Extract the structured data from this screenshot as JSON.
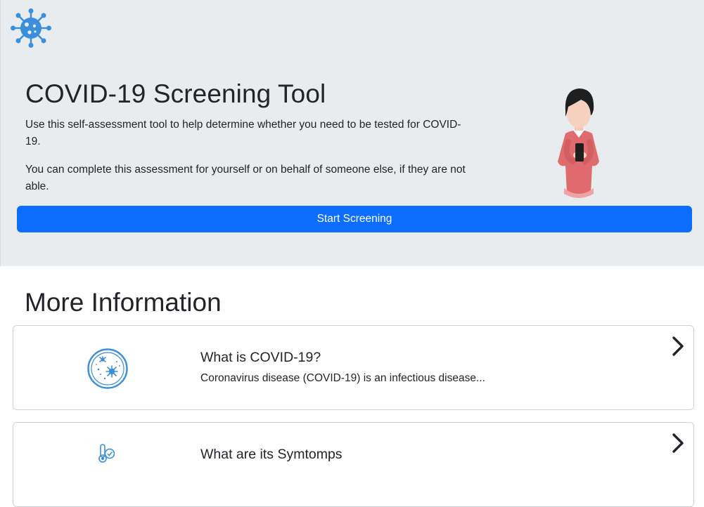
{
  "hero": {
    "title": "COVID-19 Screening Tool",
    "paragraph_1": "Use this self-assessment tool to help determine whether you need to be tested for COVID- 19.",
    "paragraph_2": "You can complete this assessment for yourself or on behalf of someone else, if they are not able.",
    "start_button_label": "Start Screening",
    "logo_icon": "virus-icon",
    "illustration": "person-with-phone-illustration"
  },
  "more_info": {
    "title": "More Information",
    "cards": [
      {
        "title": "What is COVID-19?",
        "text": "Coronavirus disease (COVID-19) is an infectious disease...",
        "icon": "virus-circle-icon"
      },
      {
        "title": "What are its Symtomps",
        "text": "",
        "icon": "thermometer-check-icon"
      }
    ]
  },
  "colors": {
    "hero_background": "#e9ecef",
    "primary_button": "#0d6efd",
    "icon_blue": "#3a8fdc",
    "sweater": "#e06b6f"
  }
}
